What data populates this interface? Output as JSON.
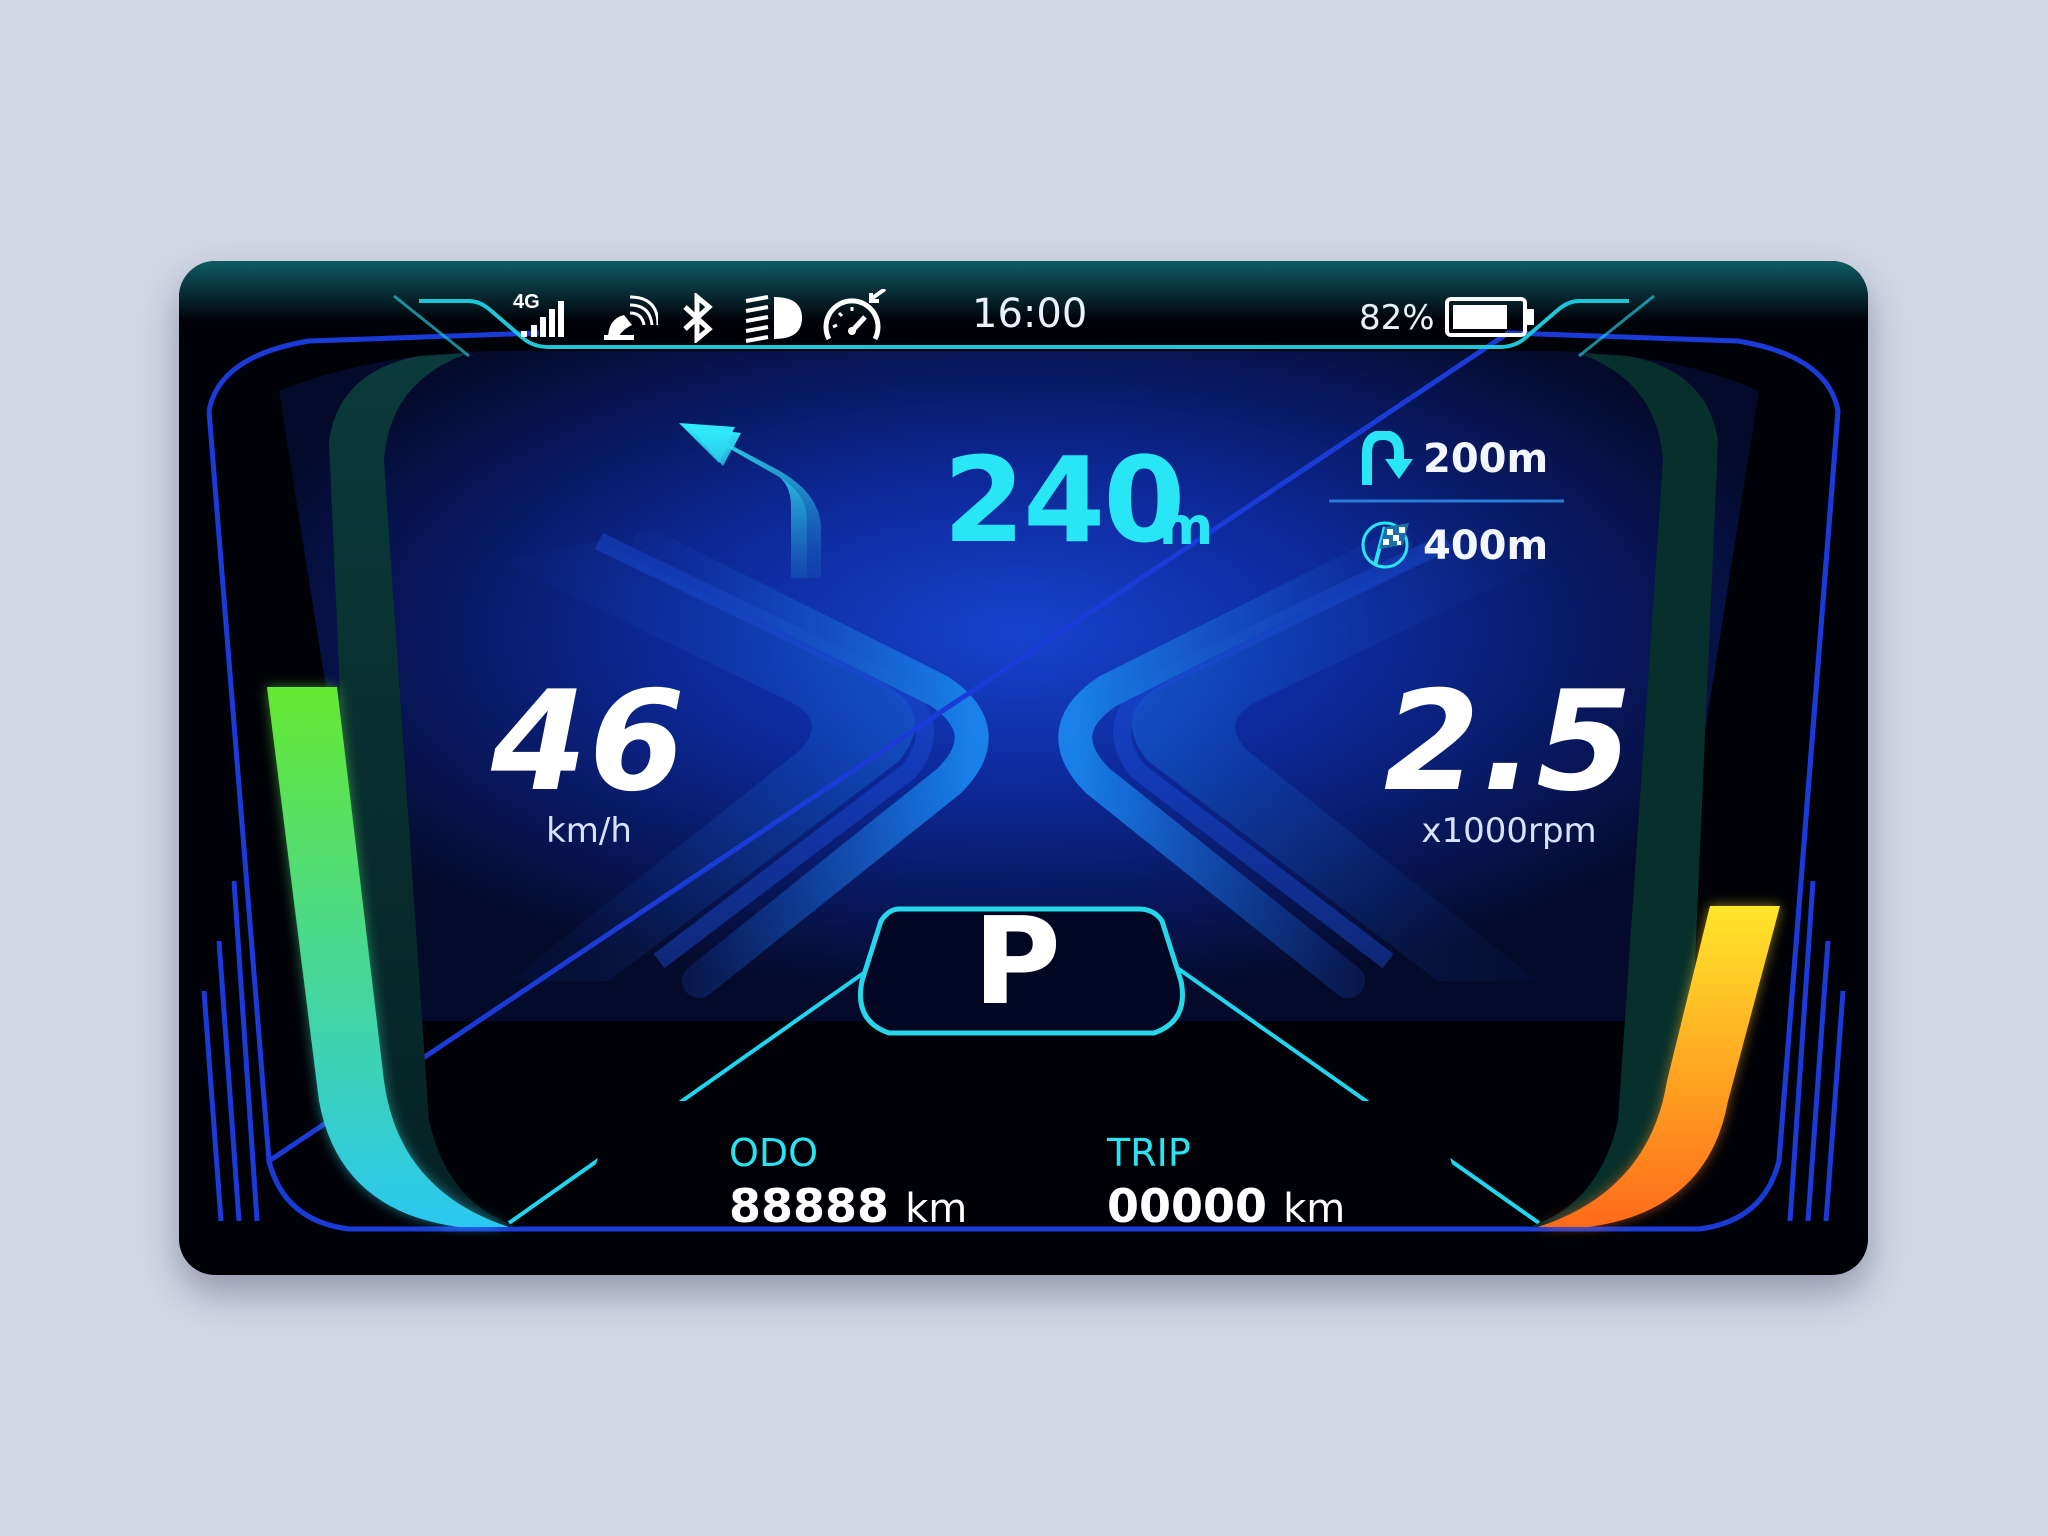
{
  "status_bar": {
    "network_label": "4G",
    "time": "16:00",
    "battery_percent": "82%",
    "battery_level": 0.82,
    "icons": [
      "4g-signal-icon",
      "gps-satellite-icon",
      "bluetooth-icon",
      "headlight-icon",
      "speedometer-icon",
      "battery-icon"
    ]
  },
  "navigation": {
    "turn_distance": "240",
    "turn_unit": "m",
    "turn_direction": "left",
    "next_u_turn": "200m",
    "destination": "400m"
  },
  "speed": {
    "value": "46",
    "unit": "km/h",
    "level": 0.65
  },
  "rpm": {
    "value": "2.5",
    "unit": "x1000rpm",
    "level": 0.45
  },
  "gear": "P",
  "odometer": {
    "label": "ODO",
    "value": "88888",
    "unit": "km"
  },
  "trip": {
    "label": "TRIP",
    "value": "00000",
    "unit": "km"
  },
  "colors": {
    "accent": "#29e6f6",
    "speed_gradient": [
      "#66e832",
      "#2ac8f0"
    ],
    "rpm_gradient": [
      "#ffe62a",
      "#ff6a1a"
    ],
    "frame": "#1b3bd8"
  }
}
